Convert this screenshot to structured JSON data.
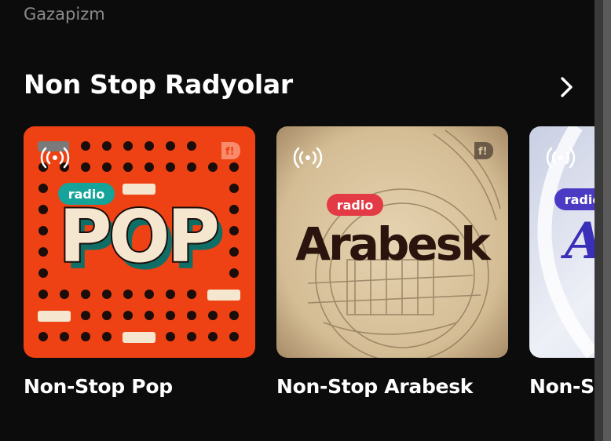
{
  "previous_item": {
    "caption": "Gazapizm"
  },
  "section": {
    "title": "Non Stop Radyolar",
    "next_icon": "chevron-right-icon"
  },
  "stations": [
    {
      "name": "Non-Stop Pop",
      "art_word": "POP",
      "art_tag": "radio",
      "accent": "#ee4214"
    },
    {
      "name": "Non-Stop Arabesk",
      "art_word": "Arabesk",
      "art_tag": "radio",
      "accent": "#e23b45"
    },
    {
      "name": "Non-Stop Aşk",
      "art_word": "A",
      "art_tag": "radio",
      "accent": "#4b3bc4"
    }
  ],
  "colors": {
    "background": "#0c0c0c",
    "text": "#ffffff",
    "muted": "#8a8a8a"
  }
}
